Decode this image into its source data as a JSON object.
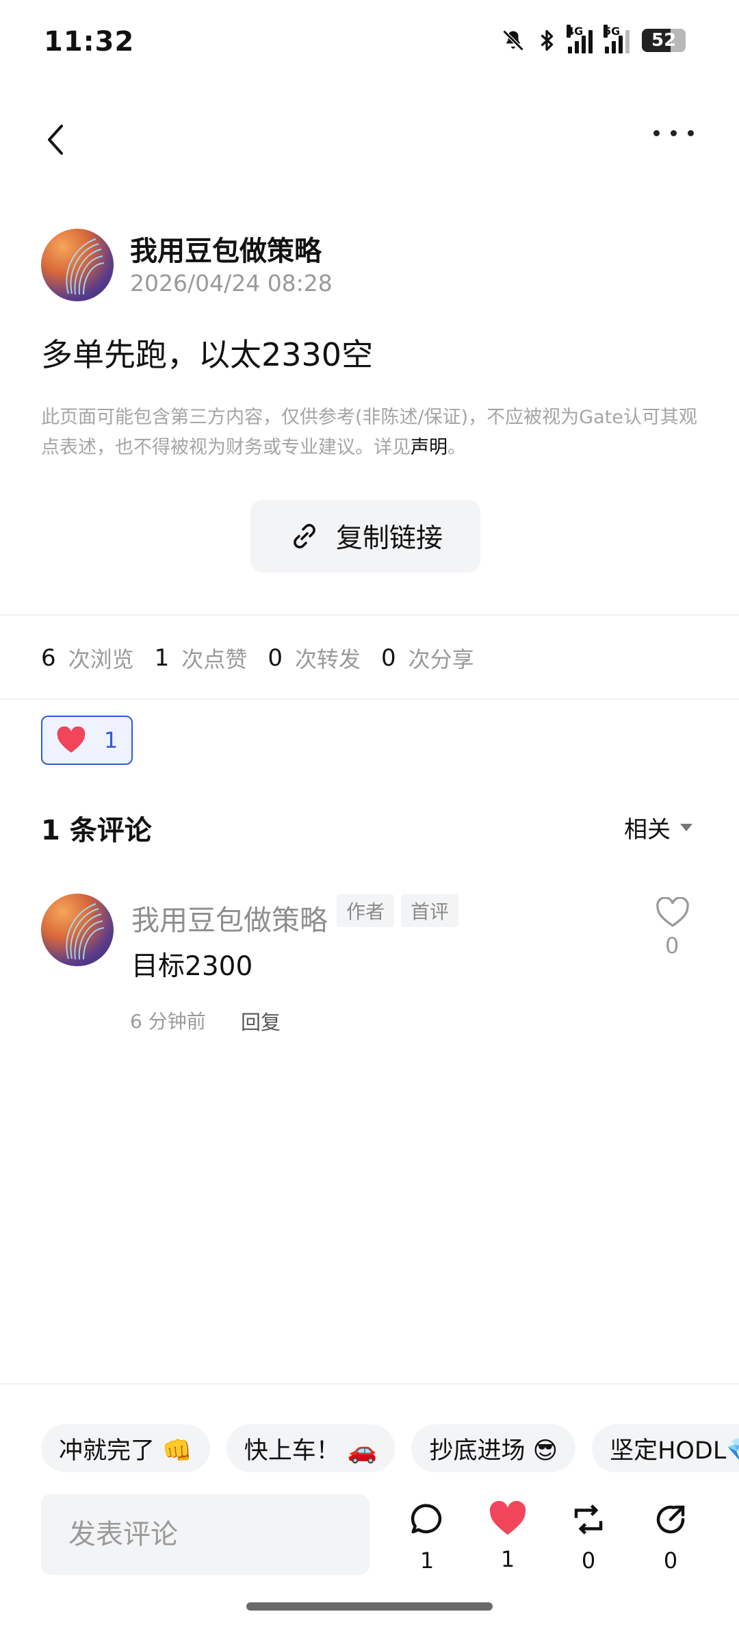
{
  "status_bar": {
    "time": "11:32",
    "battery": "52",
    "net1": "4G",
    "net2": "5G"
  },
  "post": {
    "author": "我用豆包做策略",
    "time": "2026/04/24 08:28",
    "content": "多单先跑，以太2330空",
    "disclaimer": "此页面可能包含第三方内容，仅供参考(非陈述/保证)，不应被视为Gate认可其观点表述，也不得被视为财务或专业建议。详见",
    "disclaimer_link": "声明",
    "disclaimer_end": "。",
    "copy_link_label": "复制链接"
  },
  "stats": [
    {
      "num": "6",
      "label": "次浏览"
    },
    {
      "num": "1",
      "label": "次点赞"
    },
    {
      "num": "0",
      "label": "次转发"
    },
    {
      "num": "0",
      "label": "次分享"
    }
  ],
  "like_chip": {
    "count": "1"
  },
  "comments": {
    "title": "1 条评论",
    "sort_label": "相关",
    "items": [
      {
        "author": "我用豆包做策略",
        "tags": [
          "作者",
          "首评"
        ],
        "text": "目标2300",
        "time": "6 分钟前",
        "reply_label": "回复",
        "likes": "0"
      }
    ]
  },
  "quick_replies": [
    "冲就完了 👊",
    "快上车！ 🚗",
    "抄底进场 😎",
    "坚定HODL💎"
  ],
  "bottom_bar": {
    "input_placeholder": "发表评论",
    "comment_count": "1",
    "like_count": "1",
    "repost_count": "0",
    "share_count": "0"
  },
  "colors": {
    "accent": "#2f5bd8",
    "like_red": "#f0455a",
    "muted": "#9a9a9a"
  }
}
